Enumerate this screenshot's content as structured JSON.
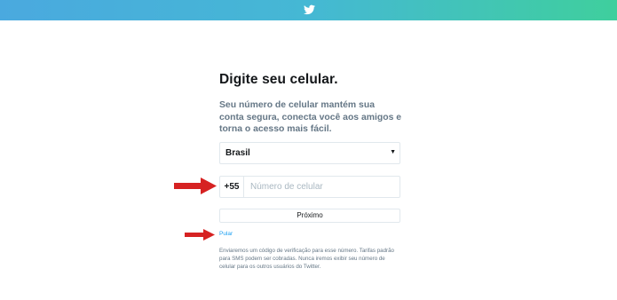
{
  "header": {
    "logo_icon": "twitter-bird-icon",
    "gradient_start": "#4aa9df",
    "gradient_end": "#3fcf9d"
  },
  "form": {
    "title": "Digite seu celular.",
    "subtitle": "Seu número de celular mantém sua conta segura, conecta você aos amigos e torna o acesso mais fácil.",
    "country_selected": "Brasil",
    "country_prefix": "+55",
    "phone_placeholder": "Número de celular",
    "phone_value": "",
    "next_label": "Próximo",
    "skip_label": "Pular",
    "disclaimer": "Enviaremos um código de verificação para esse número. Tarifas padrão para SMS podem ser cobradas. Nunca iremos exibir seu número de celular para os outros usuários do Twitter."
  },
  "annotations": {
    "arrow_icon": "red-arrow-icon",
    "arrow_color": "#d62222"
  }
}
